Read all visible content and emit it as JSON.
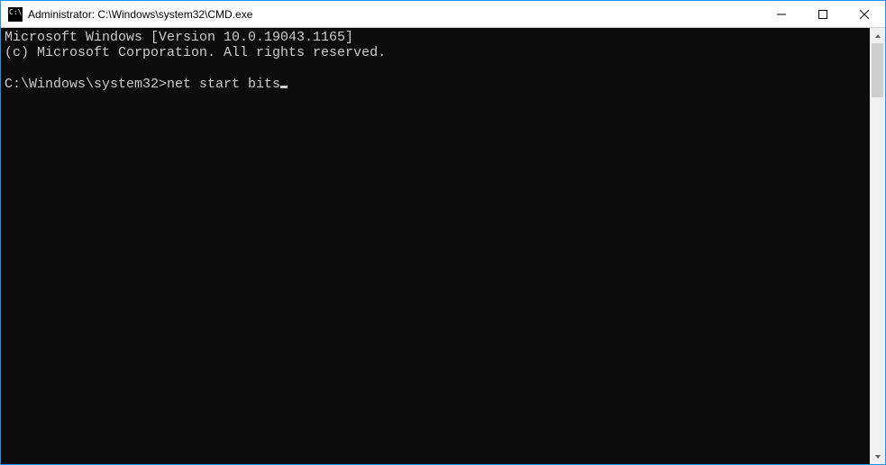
{
  "titlebar": {
    "title": "Administrator: C:\\Windows\\system32\\CMD.exe"
  },
  "terminal": {
    "line1": "Microsoft Windows [Version 10.0.19043.1165]",
    "line2": "(c) Microsoft Corporation. All rights reserved.",
    "blank": "",
    "prompt_path": "C:\\Windows\\system32>",
    "command": "net start bits"
  }
}
